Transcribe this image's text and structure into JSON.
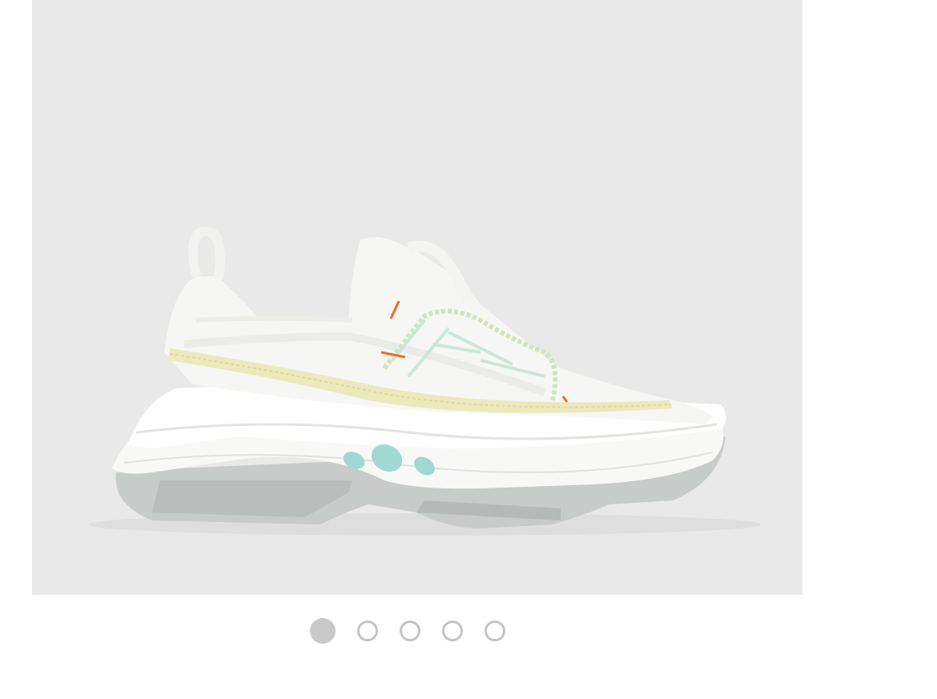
{
  "product_gallery": {
    "image_subject": "sneaker",
    "background_color": "#e9e9e9",
    "slide_count": 5,
    "active_index": 0,
    "dots": [
      {
        "active": true
      },
      {
        "active": false
      },
      {
        "active": false
      },
      {
        "active": false
      },
      {
        "active": false
      }
    ],
    "colors": {
      "upper": "#f7f7f5",
      "sole_gray": "#c7cbc9",
      "stitch_yellow": "#e8e6b0",
      "accent_orange": "#f26a2a",
      "accent_mint": "#9fd9d1",
      "dot_active": "#c9c9c9",
      "dot_inactive_border": "#c4c4c4"
    }
  }
}
